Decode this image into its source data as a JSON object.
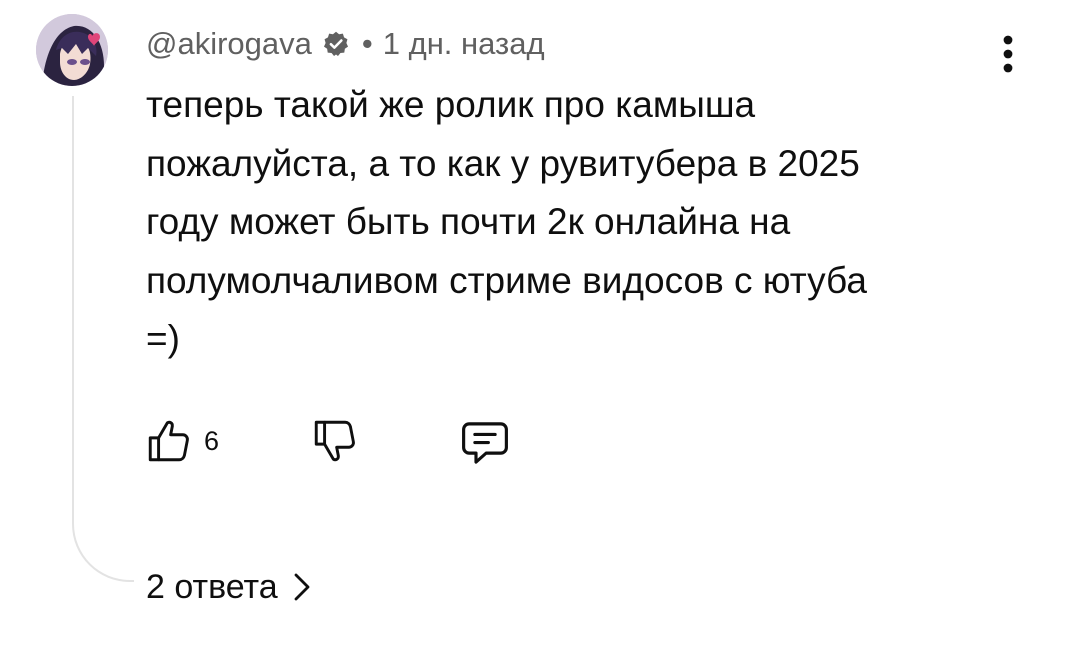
{
  "comment": {
    "author": "@akirogava",
    "verified_icon": "verified-badge-icon",
    "separator": "•",
    "timestamp": "1 дн. назад",
    "text": "теперь такой же ролик про камыша\nпожалуйста, а то как у рувитубера в 2025\nгоду может быть почти 2к онлайна на\nполумолчаливом стриме видосов с ютуба\n=)",
    "like_count": "6",
    "replies_label": "2 ответа"
  },
  "icons": {
    "avatar": "avatar-image",
    "menu": "more-vert-icon",
    "like": "thumb-up-icon",
    "dislike": "thumb-down-icon",
    "reply": "reply-comment-icon",
    "chevron": "chevron-right-icon"
  },
  "colors": {
    "text_primary": "#0f0f0f",
    "text_secondary": "#606060",
    "thread_line": "#e3e3e3",
    "background": "#ffffff"
  }
}
